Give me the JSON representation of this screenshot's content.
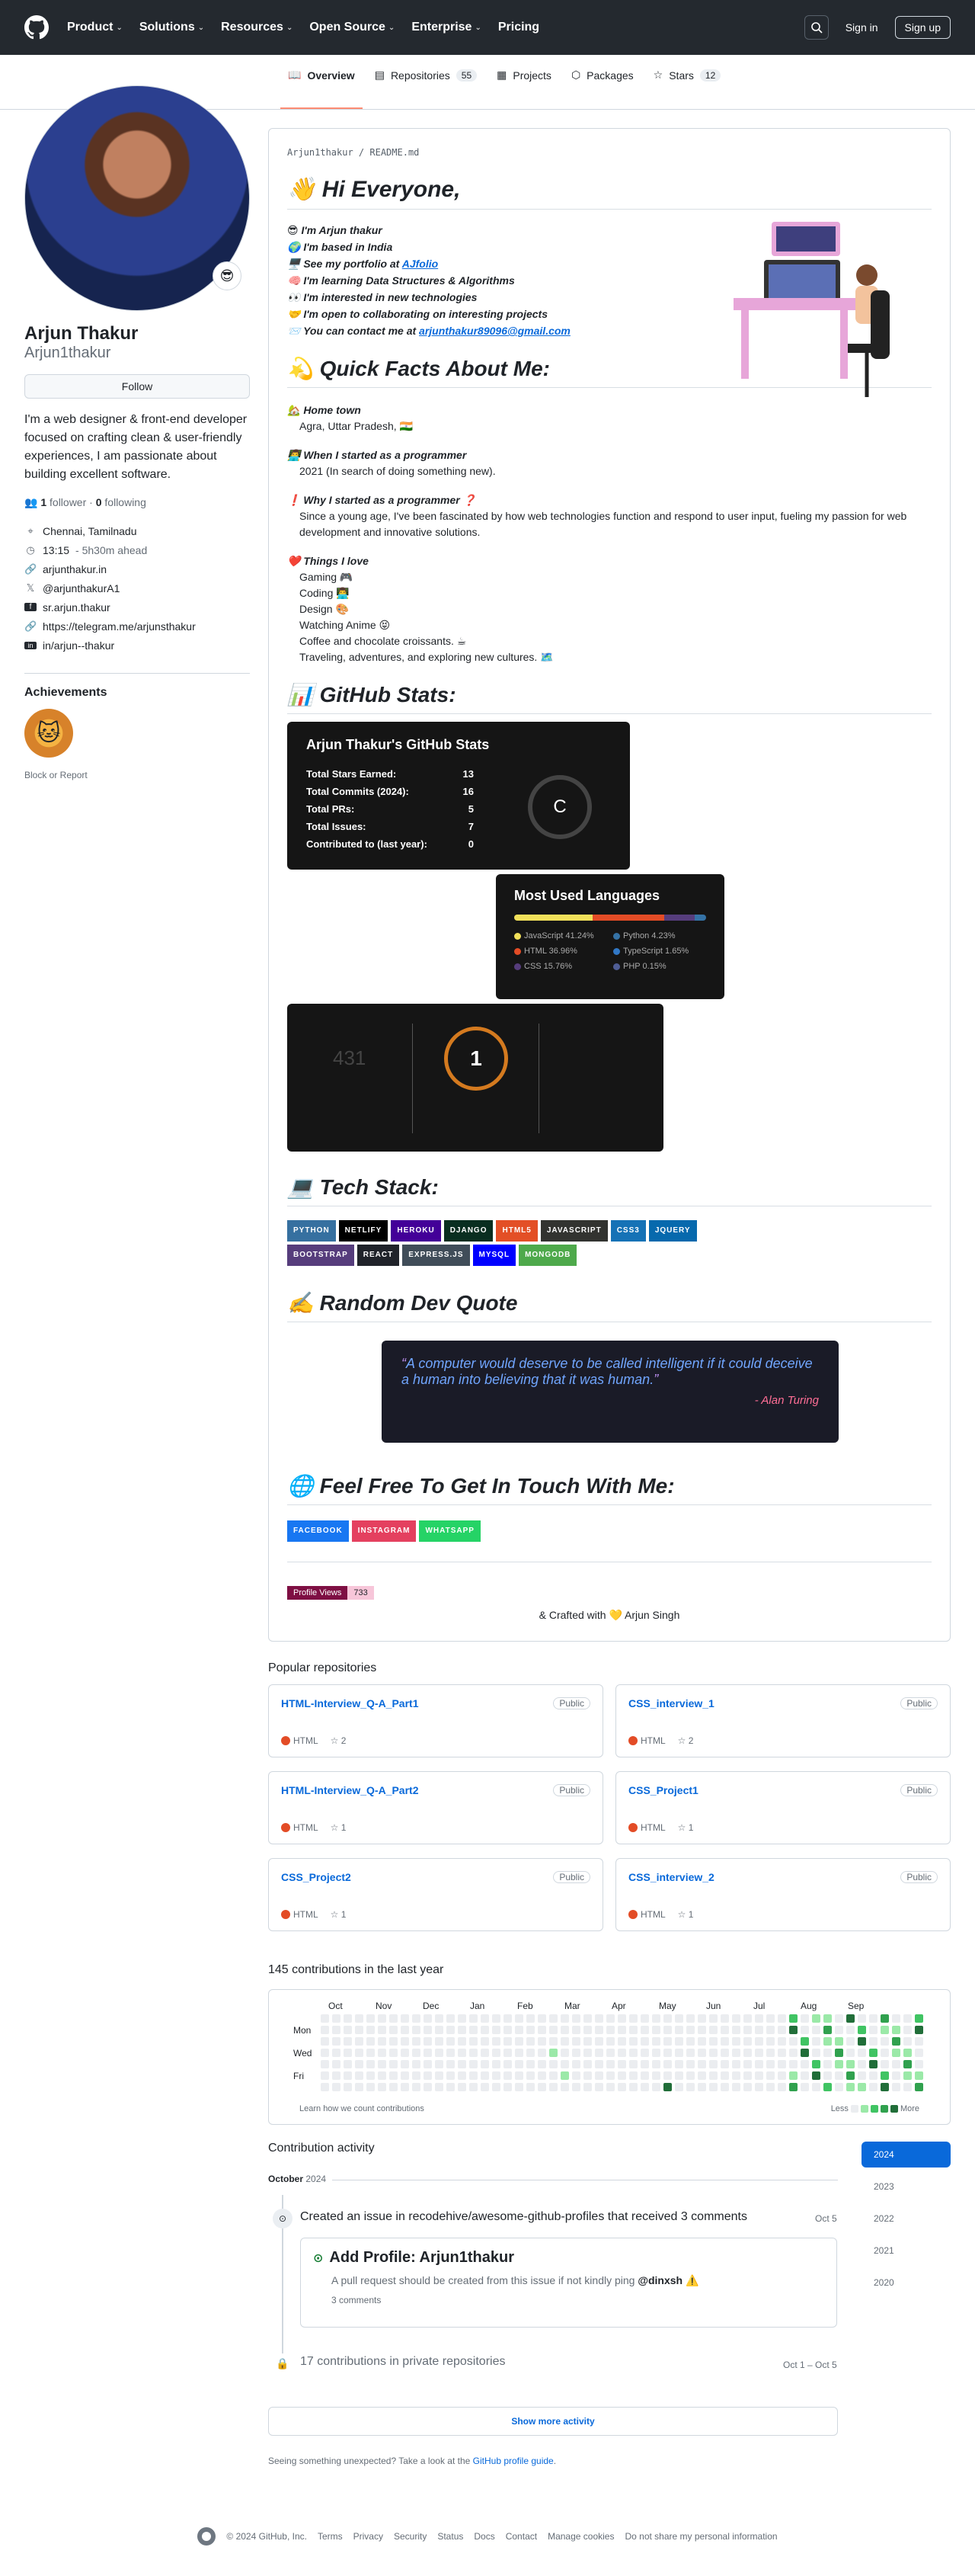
{
  "header": {
    "nav": [
      "Product",
      "Solutions",
      "Resources",
      "Open Source",
      "Enterprise",
      "Pricing"
    ],
    "signin": "Sign in",
    "signup": "Sign up"
  },
  "tabs": [
    {
      "label": "Overview",
      "count": ""
    },
    {
      "label": "Repositories",
      "count": "55"
    },
    {
      "label": "Projects",
      "count": ""
    },
    {
      "label": "Packages",
      "count": ""
    },
    {
      "label": "Stars",
      "count": "12"
    }
  ],
  "profile": {
    "name": "Arjun Thakur",
    "login": "Arjun1thakur",
    "follow": "Follow",
    "bio": "I'm a web designer & front-end developer focused on crafting clean & user-friendly experiences, I am passionate about building excellent software.",
    "followers": "1",
    "followers_label": "follower",
    "following": "0",
    "following_label": "following",
    "location": "Chennai, Tamilnadu",
    "time": "13:15",
    "time_note": "- 5h30m ahead",
    "website": "arjunthakur.in",
    "twitter": "@arjunthakurA1",
    "facebook": "sr.arjun.thakur",
    "telegram": "https://telegram.me/arjunsthakur",
    "linkedin": "in/arjun--thakur",
    "achievements": "Achievements",
    "block": "Block or Report"
  },
  "readme": {
    "path": "Arjun1thakur / README.md",
    "hi": "👋 Hi Everyone,",
    "intro": [
      "😎 I'm Arjun thakur",
      "🌍 I'm based in India",
      "🖥️ See my portfolio at AJfolio",
      "🧠 I'm learning Data Structures & Algorithms",
      "👀 I'm interested in new technologies",
      "🤝 I'm open to collaborating on interesting projects",
      "📨 You can contact me at arjunthakur89096@gmail.com"
    ],
    "facts_title": "💫 Quick Facts About Me:",
    "hometown_h": "🏡 Home town",
    "hometown": "Agra, Uttar Pradesh, 🇮🇳",
    "started_h": "👨‍💻 When I started as a programmer",
    "started": "2021 (In search of doing something new).",
    "why_h": "❗ Why I started as a programmer ❓",
    "why": "Since a young age, I've been fascinated by how web technologies function and respond to user input, fueling my passion for web development and innovative solutions.",
    "love_h": "❤️ Things I love",
    "loves": [
      "Gaming 🎮",
      "Coding 👨‍💻",
      "Design 🎨",
      "Watching Anime 😝",
      "Coffee and chocolate croissants. ☕",
      "Traveling, adventures, and exploring new cultures. 🗺️"
    ],
    "stats_title": "📊 GitHub Stats:",
    "stats": {
      "title": "Arjun Thakur's GitHub Stats",
      "rows": [
        [
          "Total Stars Earned:",
          "13"
        ],
        [
          "Total Commits (2024):",
          "16"
        ],
        [
          "Total PRs:",
          "5"
        ],
        [
          "Total Issues:",
          "7"
        ],
        [
          "Contributed to (last year):",
          "0"
        ]
      ],
      "grade": "C"
    },
    "langs": {
      "title": "Most Used Languages",
      "items": [
        [
          "JavaScript 41.24%",
          "#f1e05a"
        ],
        [
          "Python 4.23%",
          "#3572A5"
        ],
        [
          "HTML 36.96%",
          "#e34c26"
        ],
        [
          "TypeScript 1.65%",
          "#3178c6"
        ],
        [
          "CSS 15.76%",
          "#563d7c"
        ],
        [
          "PHP 0.15%",
          "#4F5D95"
        ]
      ]
    },
    "streak": {
      "total": "431",
      "current": "1"
    },
    "tech_title": "💻 Tech Stack:",
    "tech": [
      [
        "PYTHON",
        "#3670A0"
      ],
      [
        "NETLIFY",
        "#000000"
      ],
      [
        "HEROKU",
        "#430098"
      ],
      [
        "DJANGO",
        "#092E20"
      ],
      [
        "HTML5",
        "#E34F26"
      ],
      [
        "JAVASCRIPT",
        "#323330"
      ],
      [
        "CSS3",
        "#1572B6"
      ],
      [
        "JQUERY",
        "#0769AD"
      ],
      [
        "BOOTSTRAP",
        "#563D7C"
      ],
      [
        "REACT",
        "#20232a"
      ],
      [
        "EXPRESS.JS",
        "#404d59"
      ],
      [
        "MYSQL",
        "#00f"
      ],
      [
        "MONGODB",
        "#4ea94b"
      ]
    ],
    "quote_title": "✍️ Random Dev Quote",
    "quote": "A computer would deserve to be called intelligent if it could deceive a human into believing that it was human.",
    "quote_author": "- Alan Turing",
    "touch_title": "🌐 Feel Free To Get In Touch With Me:",
    "social": [
      [
        "FACEBOOK",
        "#1877F2"
      ],
      [
        "INSTAGRAM",
        "#E4405F"
      ],
      [
        "WHATSAPP",
        "#25D366"
      ]
    ],
    "views_label": "Profile Views",
    "views": "733",
    "crafted": "& Crafted with 💛 Arjun Singh"
  },
  "popular": {
    "title": "Popular repositories",
    "repos": [
      [
        "HTML-Interview_Q-A_Part1",
        "2"
      ],
      [
        "CSS_interview_1",
        "2"
      ],
      [
        "HTML-Interview_Q-A_Part2",
        "1"
      ],
      [
        "CSS_Project1",
        "1"
      ],
      [
        "CSS_Project2",
        "1"
      ],
      [
        "CSS_interview_2",
        "1"
      ]
    ],
    "public": "Public",
    "lang": "HTML"
  },
  "contrib": {
    "title": "145 contributions in the last year",
    "months": [
      "Oct",
      "Nov",
      "Dec",
      "Jan",
      "Feb",
      "Mar",
      "Apr",
      "May",
      "Jun",
      "Jul",
      "Aug",
      "Sep"
    ],
    "days": [
      "Mon",
      "Wed",
      "Fri"
    ],
    "learn": "Learn how we count contributions",
    "less": "Less",
    "more": "More"
  },
  "activity": {
    "title": "Contribution activity",
    "month": "October",
    "year": "2024",
    "issue_text": "Created an issue in recodehive/awesome-github-profiles that received 3 comments",
    "issue_date": "Oct 5",
    "pr_title": "Add Profile: Arjun1thakur",
    "pr_body": "A pull request should be created from this issue if not kindly ping",
    "pr_ping": "@dinxsh",
    "pr_comments": "3 comments",
    "private": "17 contributions in private repositories",
    "private_date": "Oct 1 – Oct 5",
    "more": "Show more activity",
    "unexpected": "Seeing something unexpected? Take a look at the",
    "guide": "GitHub profile guide",
    "years": [
      "2024",
      "2023",
      "2022",
      "2021",
      "2020"
    ]
  },
  "footer": {
    "copy": "© 2024 GitHub, Inc.",
    "links": [
      "Terms",
      "Privacy",
      "Security",
      "Status",
      "Docs",
      "Contact",
      "Manage cookies",
      "Do not share my personal information"
    ]
  }
}
